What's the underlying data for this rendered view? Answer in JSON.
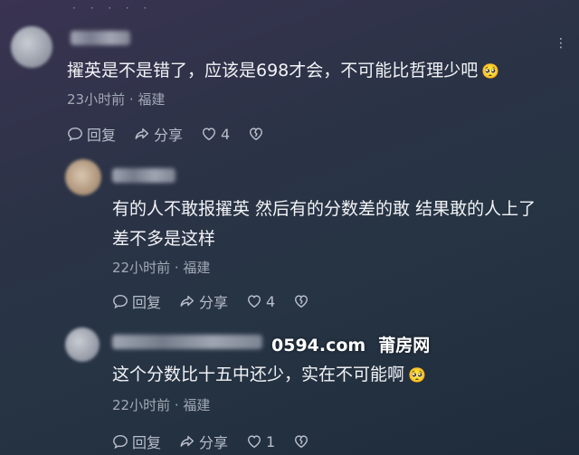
{
  "comments": [
    {
      "content": "擢英是不是错了，应该是698才会，不可能比哲理少吧",
      "emoji": "🥺",
      "meta": "23小时前 · 福建",
      "reply_label": "回复",
      "share_label": "分享",
      "like_count": "4"
    },
    {
      "content_line1": "有的人不敢报擢英 然后有的分数差的敢 结果敢的人上了",
      "content_line2": "差不多是这样",
      "meta": "22小时前 · 福建",
      "reply_label": "回复",
      "share_label": "分享",
      "like_count": "4"
    },
    {
      "content": "这个分数比十五中还少，实在不可能啊",
      "emoji": "🥺",
      "meta": "22小时前 · 福建",
      "reply_label": "回复",
      "share_label": "分享",
      "like_count": "1"
    }
  ],
  "watermark": {
    "domain": "0594.com",
    "brand": "莆房网"
  },
  "icons": {
    "more": "more-dots-icon",
    "reply": "comment-bubble-icon",
    "share": "share-arrow-icon",
    "like": "heart-icon",
    "dislike": "broken-heart-icon"
  }
}
